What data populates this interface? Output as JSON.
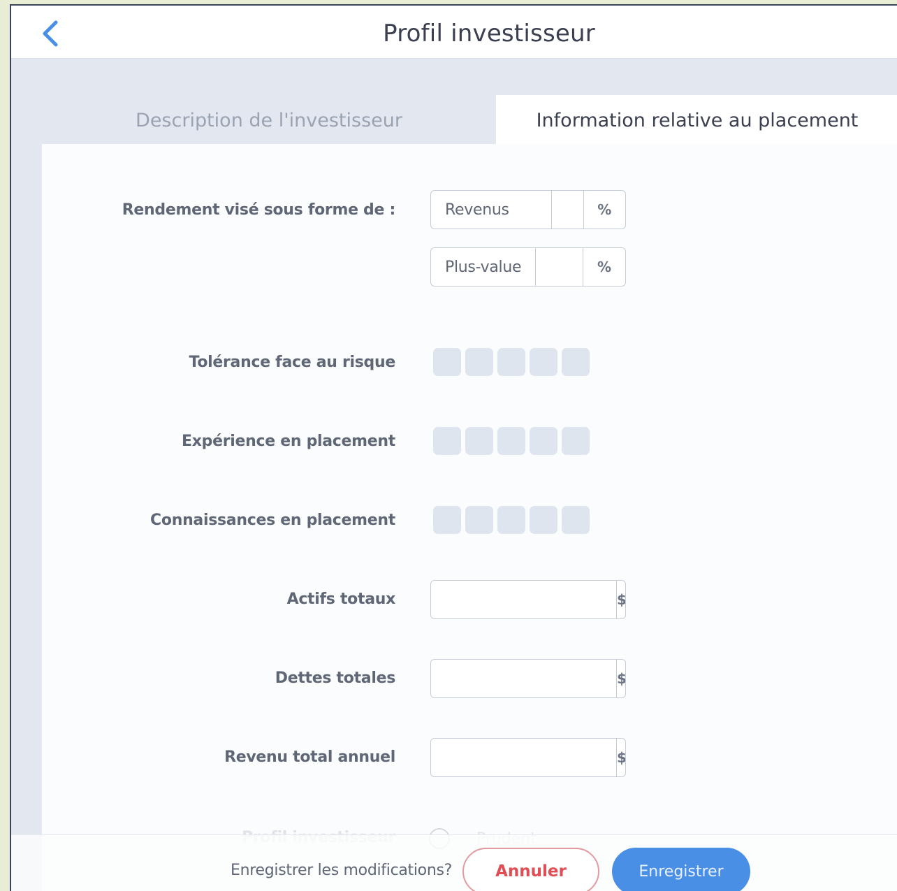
{
  "header": {
    "title": "Profil investisseur",
    "back_icon": "chevron-left-icon"
  },
  "tabs": [
    {
      "label": "Description de l'investisseur",
      "active": false
    },
    {
      "label": "Information relative au placement",
      "active": true
    }
  ],
  "form": {
    "rendement": {
      "label": "Rendement visé sous forme de :",
      "revenus": {
        "name": "Revenus",
        "value": "",
        "unit": "%"
      },
      "plus_value": {
        "name": "Plus-value",
        "value": "",
        "unit": "%"
      }
    },
    "tolerance": {
      "label": "Tolérance face au risque",
      "level": 0,
      "max": 5
    },
    "experience": {
      "label": "Expérience en placement",
      "level": 0,
      "max": 5
    },
    "connaissances": {
      "label": "Connaissances en placement",
      "level": 0,
      "max": 5
    },
    "actifs": {
      "label": "Actifs totaux",
      "value": "",
      "unit": "$"
    },
    "dettes": {
      "label": "Dettes totales",
      "value": "",
      "unit": "$"
    },
    "revenu": {
      "label": "Revenu total annuel",
      "value": "",
      "unit": "$"
    },
    "profil": {
      "label": "Profil investisseur",
      "option": "Prudent"
    }
  },
  "footer": {
    "question": "Enregistrer les modifications?",
    "cancel_label": "Annuler",
    "save_label": "Enregistrer"
  },
  "colors": {
    "accent": "#4a8fe6",
    "cancel": "#e04d55",
    "rating_empty": "#dfe5ef"
  }
}
